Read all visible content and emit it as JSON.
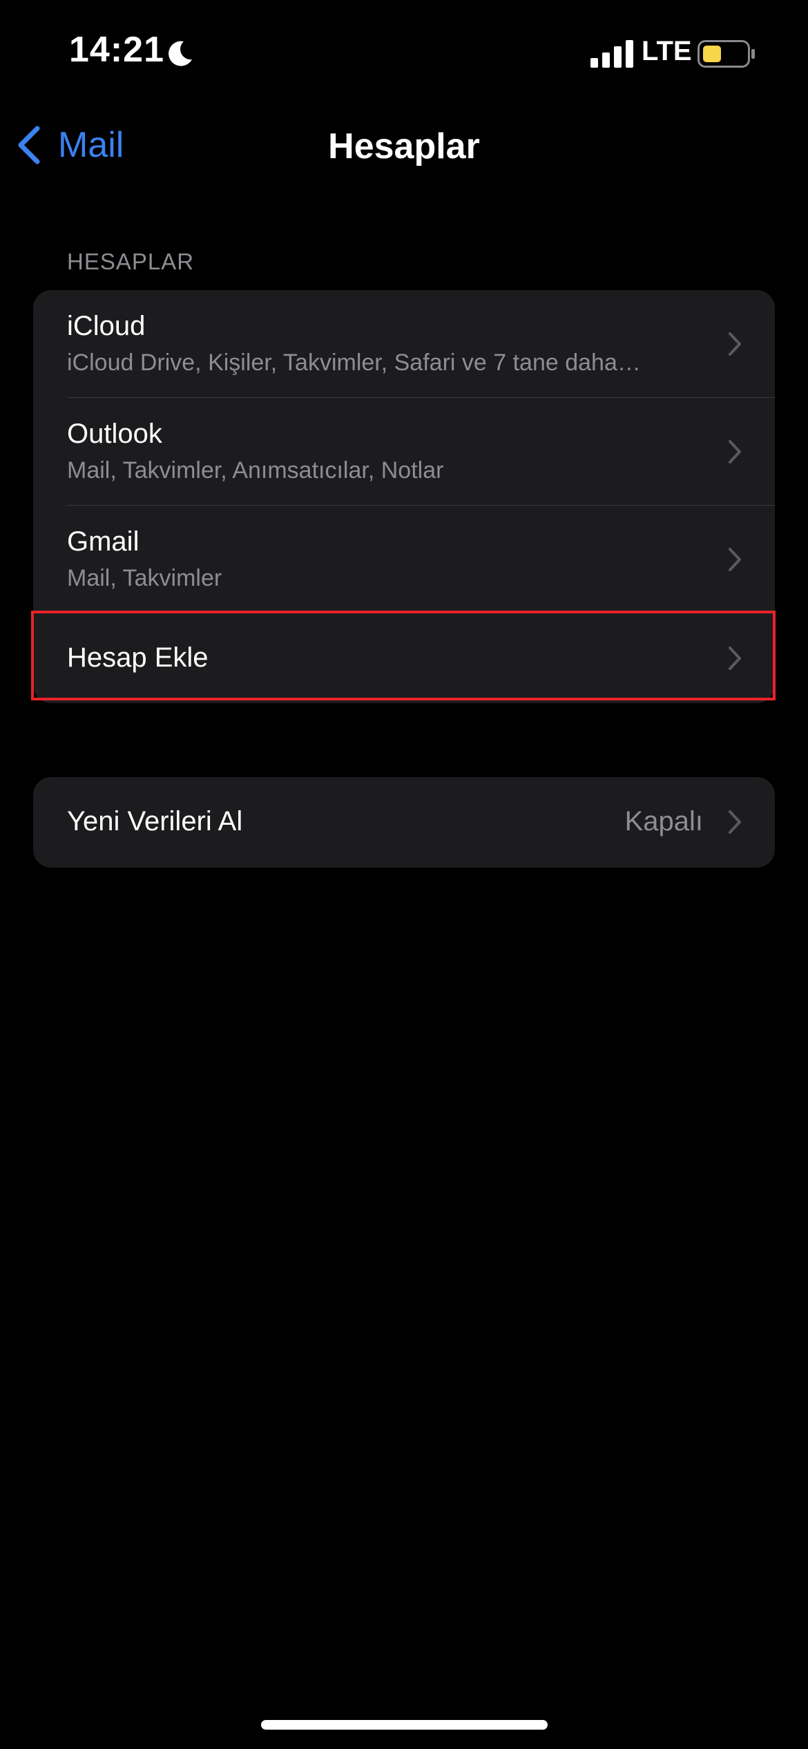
{
  "status_bar": {
    "time": "14:21",
    "network": "LTE",
    "battery_color": "#f7d64a",
    "icons": [
      "moon-icon",
      "signal-icon",
      "battery-icon"
    ]
  },
  "nav": {
    "back_label": "Mail",
    "title": "Hesaplar",
    "accent_color": "#3b82f0"
  },
  "accounts_section": {
    "header": "HESAPLAR",
    "rows": [
      {
        "title": "iCloud",
        "subtitle": "iCloud Drive, Kişiler, Takvimler, Safari ve 7 tane daha…"
      },
      {
        "title": "Outlook",
        "subtitle": "Mail, Takvimler, Anımsatıcılar, Notlar"
      },
      {
        "title": "Gmail",
        "subtitle": "Mail, Takvimler"
      }
    ],
    "add_account": "Hesap Ekle"
  },
  "fetch_section": {
    "title": "Yeni Verileri Al",
    "value": "Kapalı"
  },
  "highlight_color": "#e8232a"
}
